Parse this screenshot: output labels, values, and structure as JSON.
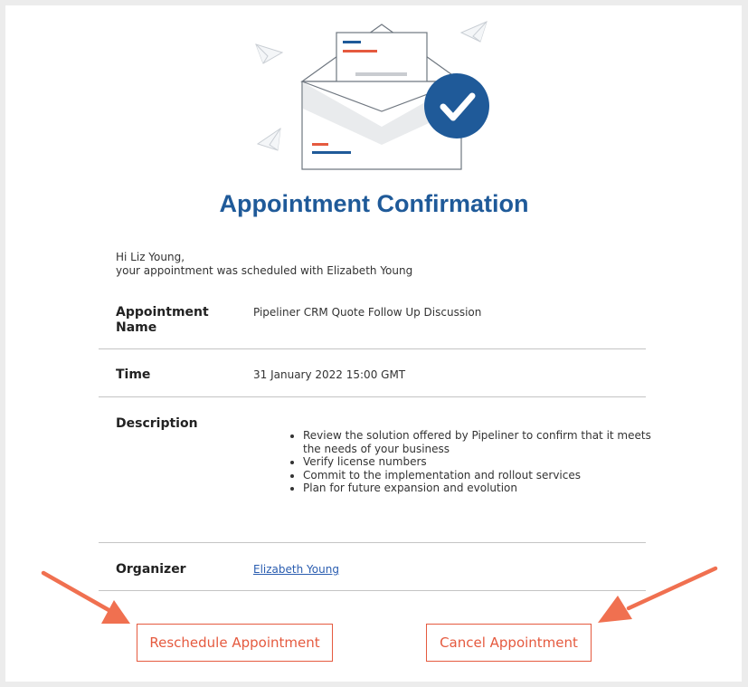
{
  "email": {
    "title": "Appointment Confirmation",
    "greeting_line1": "Hi Liz Young,",
    "greeting_line2": "your appointment was scheduled with Elizabeth Young"
  },
  "details": {
    "appointment_name_label": "Appointment Name",
    "appointment_name_value": "Pipeliner CRM Quote Follow Up Discussion",
    "time_label": "Time",
    "time_value": "31 January 2022 15:00 GMT",
    "description_label": "Description",
    "description_items": [
      "Review the solution offered by Pipeliner to confirm that it meets the needs of your business",
      "Verify license numbers",
      "Commit to the implementation and rollout services",
      "Plan for future expansion and evolution"
    ],
    "organizer_label": "Organizer",
    "organizer_value": "Elizabeth Young"
  },
  "actions": {
    "reschedule_label": "Reschedule Appointment",
    "cancel_label": "Cancel Appointment"
  },
  "colors": {
    "brand_blue": "#1f5a99",
    "accent_orange": "#e55a3f",
    "arrow_orange": "#f07050",
    "link_blue": "#2a5db0"
  },
  "icons": [
    "envelope-illustration",
    "checkmark-badge-icon",
    "paper-plane-icon"
  ]
}
